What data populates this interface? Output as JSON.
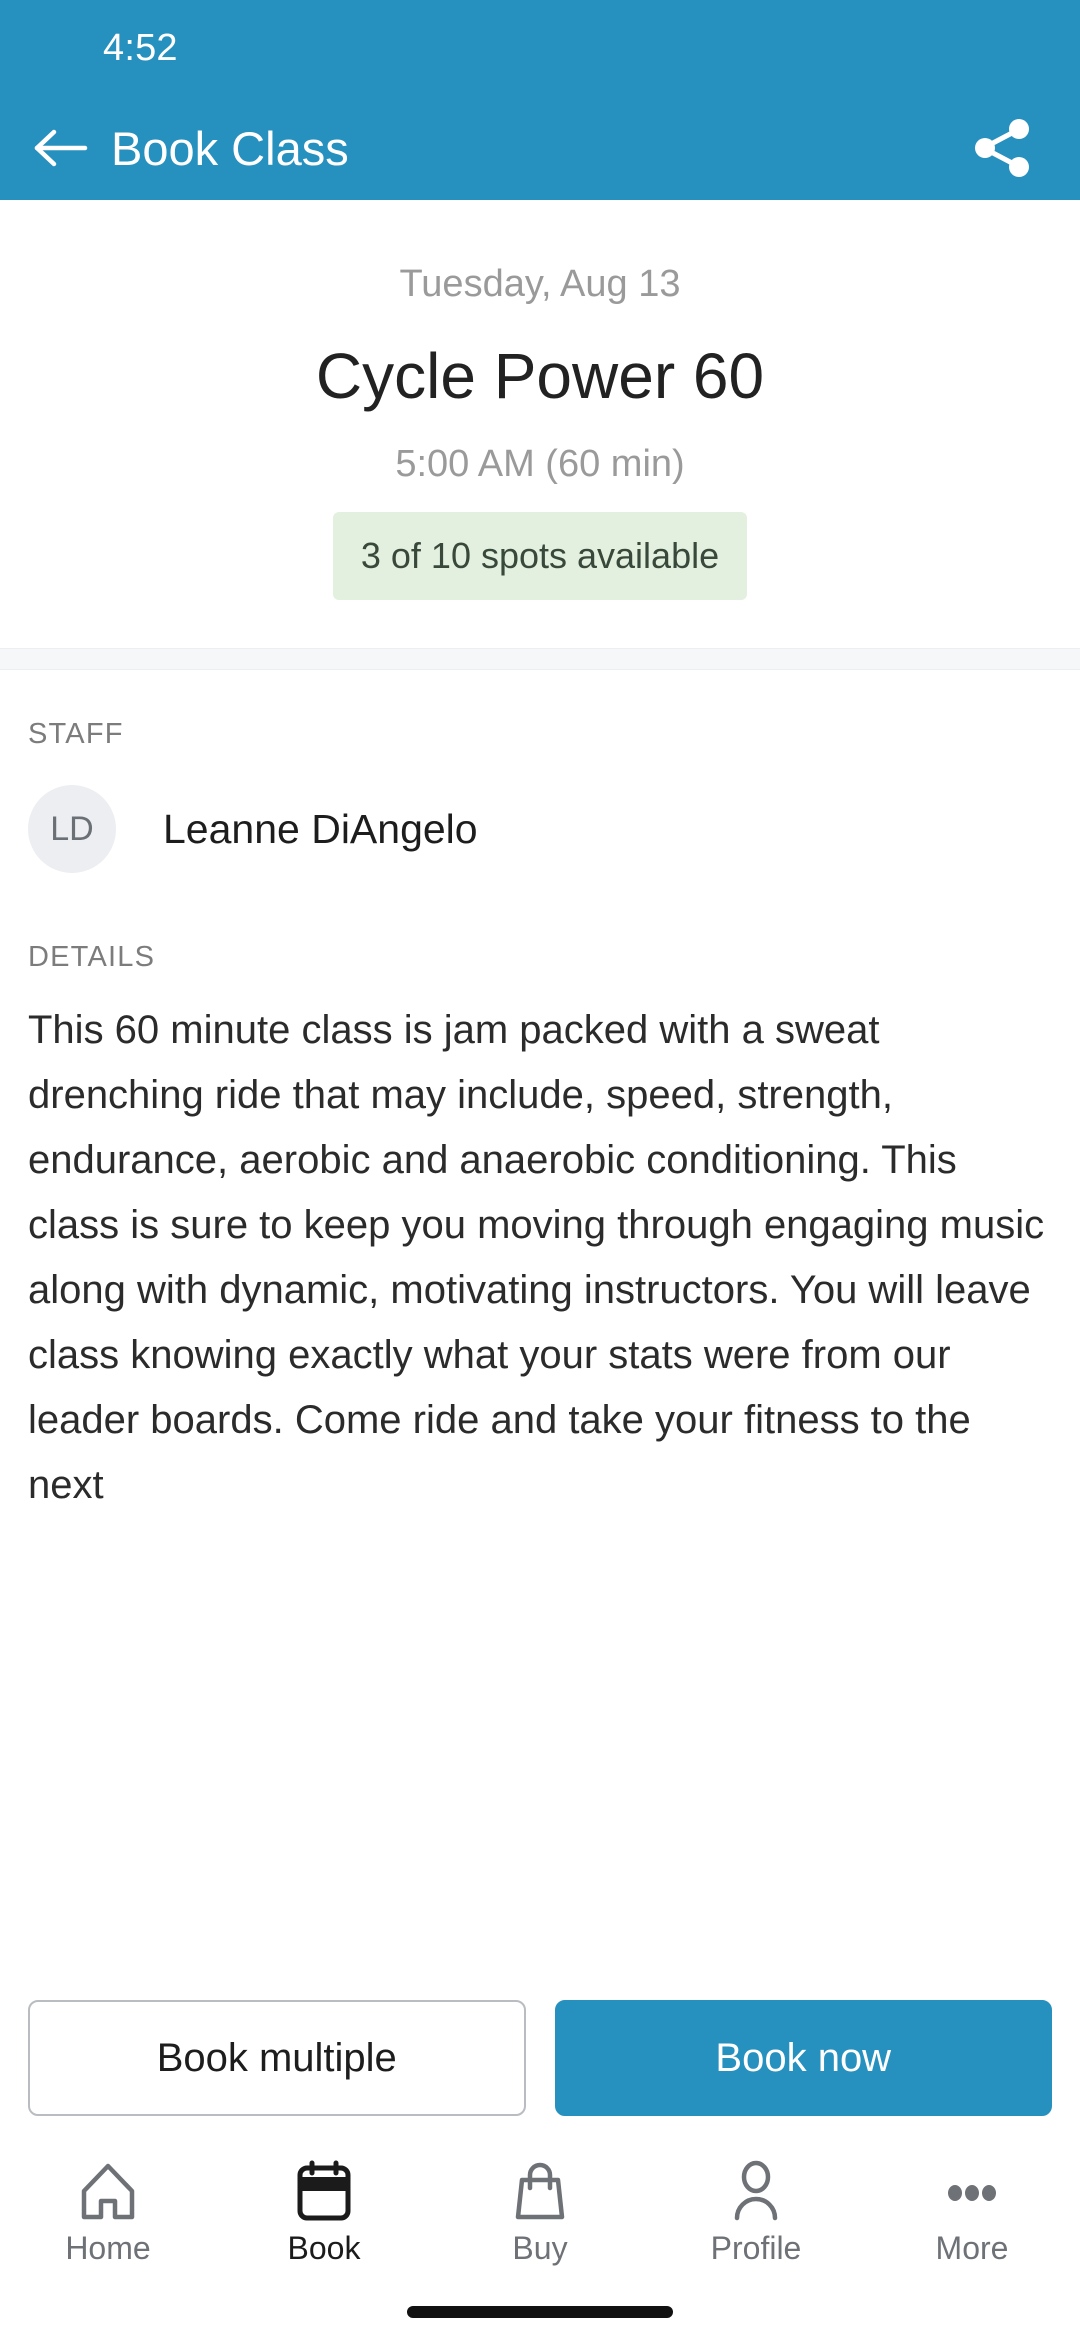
{
  "statusbar": {
    "time": "4:52"
  },
  "appbar": {
    "title": "Book Class",
    "back_icon": "back-arrow-icon",
    "share_icon": "share-icon"
  },
  "hero": {
    "date": "Tuesday, Aug 13",
    "class_name": "Cycle Power 60",
    "time": "5:00 AM (60 min)",
    "availability": "3 of 10 spots available",
    "availability_bg": "#e3f0e0",
    "availability_color": "#38483a"
  },
  "staff": {
    "label": "STAFF",
    "initials": "LD",
    "name": "Leanne DiAngelo"
  },
  "details": {
    "label": "DETAILS",
    "text": "This 60 minute class is jam packed with a sweat drenching ride that may include, speed, strength, endurance, aerobic and anaerobic conditioning.  This class is sure to keep you moving through engaging music along with dynamic, motivating instructors. You will leave class knowing exactly what your stats were from our leader boards. Come ride and take your fitness to the next"
  },
  "actions": {
    "secondary_label": "Book multiple",
    "primary_label": "Book now",
    "primary_color": "#2690be"
  },
  "bottomnav": {
    "items": [
      {
        "label": "Home",
        "icon": "home-icon",
        "active": false
      },
      {
        "label": "Book",
        "icon": "calendar-icon",
        "active": true
      },
      {
        "label": "Buy",
        "icon": "bag-icon",
        "active": false
      },
      {
        "label": "Profile",
        "icon": "person-icon",
        "active": false
      },
      {
        "label": "More",
        "icon": "ellipsis-icon",
        "active": false
      }
    ]
  },
  "theme": {
    "accent": "#2690be"
  }
}
